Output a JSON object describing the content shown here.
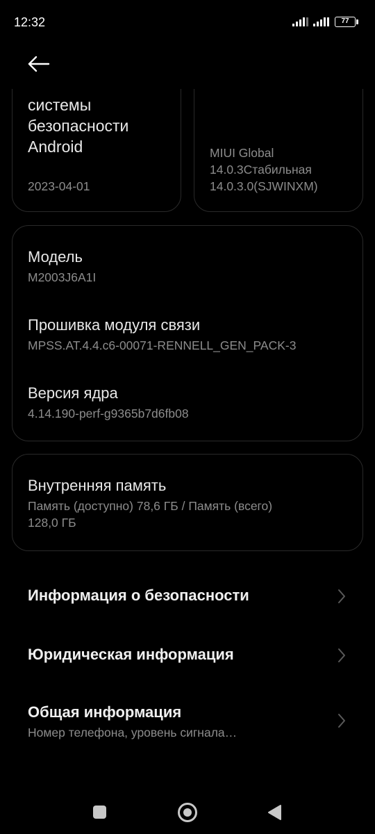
{
  "status_bar": {
    "time": "12:32",
    "battery_level": "77"
  },
  "icons": {
    "back": "arrow-left-icon",
    "chevron": "chevron-right-icon",
    "nav_recents": "square-icon",
    "nav_home": "circle-icon",
    "nav_back": "triangle-left-icon"
  },
  "cards": {
    "security_patch": {
      "title_lines": [
        "системы",
        "безопасности",
        "Android"
      ],
      "value": "2023-04-01"
    },
    "miui_version": {
      "value_lines": [
        "MIUI Global",
        "14.0.3Стабильная",
        "14.0.3.0(SJWINXM)"
      ]
    }
  },
  "specs": [
    {
      "title": "Модель",
      "value": "M2003J6A1I"
    },
    {
      "title": "Прошивка модуля связи",
      "value": "MPSS.AT.4.4.c6-00071-RENNELL_GEN_PACK-3"
    },
    {
      "title": "Версия ядра",
      "value": "4.14.190-perf-g9365b7d6fb08"
    }
  ],
  "storage": {
    "title": "Внутренняя память",
    "value_line1": "Память (доступно)  78,6 ГБ / Память (всего)",
    "value_line2": "128,0 ГБ"
  },
  "menu": [
    {
      "title": "Информация о безопасности"
    },
    {
      "title": "Юридическая информация"
    },
    {
      "title": "Общая информация",
      "subtitle": "Номер телефона, уровень сигнала…"
    }
  ],
  "colors": {
    "background": "#000000",
    "card_border": "#2a2a2a",
    "primary_text": "#e8e8e8",
    "secondary_text": "#8c8c8c"
  }
}
